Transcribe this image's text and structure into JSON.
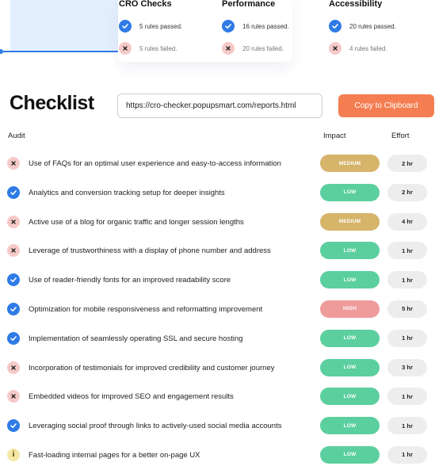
{
  "summary": {
    "columns": [
      {
        "title": "CRO Checks",
        "passed": "5 rules passed.",
        "failed": "5 rules failed."
      },
      {
        "title": "Performance",
        "passed": "16 rules passed.",
        "failed": "20 rules failed."
      },
      {
        "title": "Accessibility",
        "passed": "20 rules passed.",
        "failed": "4 rules failed."
      }
    ]
  },
  "checklist": {
    "title": "Checklist",
    "url_value": "https://cro-checker.popupsmart.com/reports.html",
    "copy_label": "Copy to Clipboard",
    "headers": {
      "audit": "Audit",
      "impact": "Impact",
      "effort": "Effort"
    },
    "rows": [
      {
        "status": "fail",
        "audit": "Use of FAQs for an optimal user experience and easy-to-access information",
        "impact": "MEDIUM",
        "effort": "2 hr"
      },
      {
        "status": "pass",
        "audit": "Analytics and conversion tracking setup for deeper insights",
        "impact": "LOW",
        "effort": "2 hr"
      },
      {
        "status": "fail",
        "audit": "Active use of a blog for organic traffic and longer session lengths",
        "impact": "MEDIUM",
        "effort": "4 hr"
      },
      {
        "status": "fail",
        "audit": "Leverage of trustworthiness with a display of phone number and address",
        "impact": "LOW",
        "effort": "1 hr"
      },
      {
        "status": "pass",
        "audit": "Use of reader-friendly fonts for an improved readability score",
        "impact": "LOW",
        "effort": "1 hr"
      },
      {
        "status": "pass",
        "audit": "Optimization for mobile responsiveness and reformatting improvement",
        "impact": "HIGH",
        "effort": "5 hr"
      },
      {
        "status": "pass",
        "audit": "Implementation of seamlessly operating SSL and secure hosting",
        "impact": "LOW",
        "effort": "1 hr"
      },
      {
        "status": "fail",
        "audit": "Incorporation of testimonials for improved credibility and customer journey",
        "impact": "LOW",
        "effort": "3 hr"
      },
      {
        "status": "fail",
        "audit": "Embedded videos for improved SEO and engagement results",
        "impact": "LOW",
        "effort": "1 hr"
      },
      {
        "status": "pass",
        "audit": "Leveraging social proof through links to actively-used social media accounts",
        "impact": "LOW",
        "effort": "1 hr"
      },
      {
        "status": "warn",
        "audit": "Fast-loading internal pages for a better on-page UX",
        "impact": "LOW",
        "effort": "1 hr"
      }
    ]
  },
  "colors": {
    "pass": "#2f7be6",
    "fail": "#f6c9c9",
    "warn": "#f7e7a6",
    "impact_medium": "#d6b46a",
    "impact_low": "#5ccf9e",
    "impact_high": "#ef9b9b",
    "copy_button": "#f47d52"
  },
  "icons": {
    "pass": "check-circle-icon",
    "fail": "x-circle-icon",
    "warn": "info-circle-icon"
  }
}
